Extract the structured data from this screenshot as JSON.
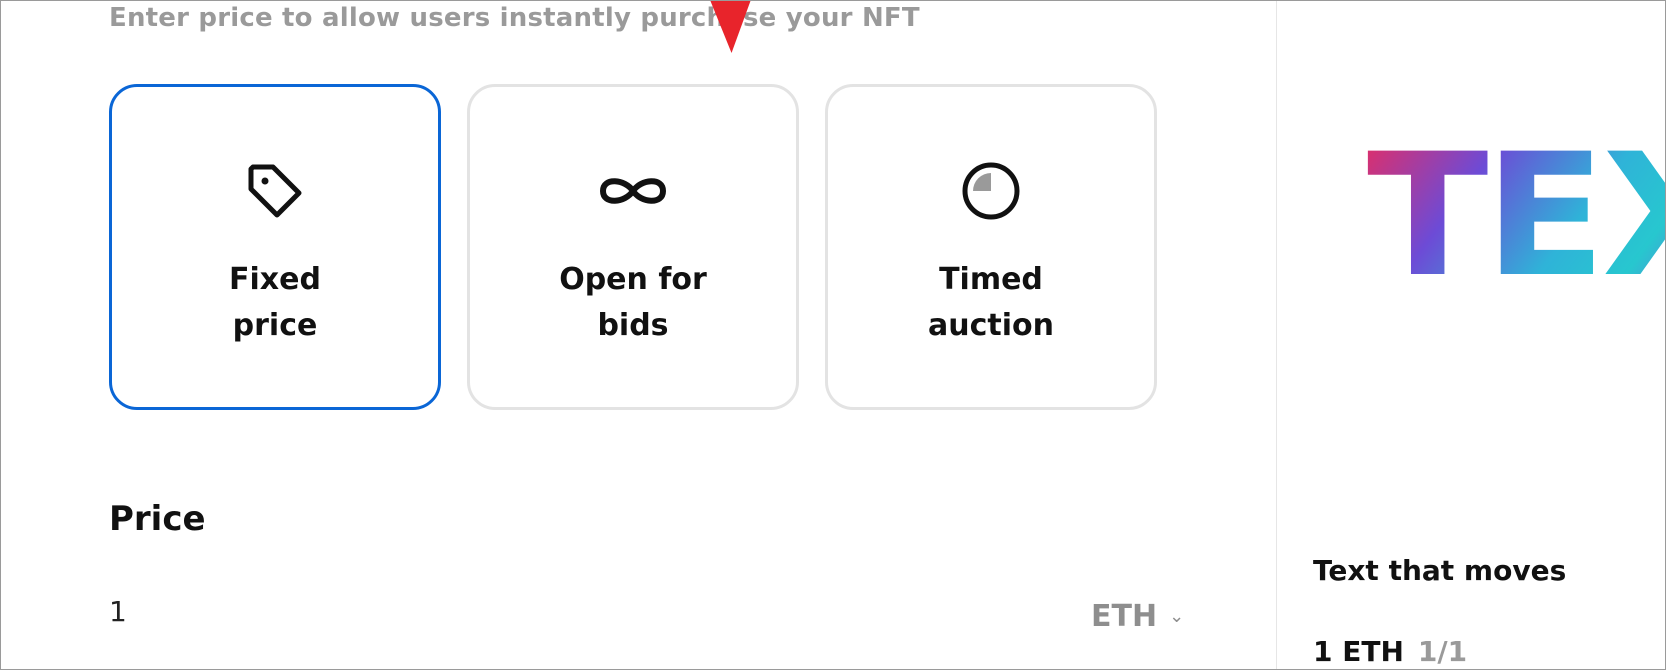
{
  "subtitle": "Enter price to allow users instantly purchase your NFT",
  "sale_options": [
    {
      "label": "Fixed\nprice",
      "icon": "price-tag-icon",
      "selected": true
    },
    {
      "label": "Open for\nbids",
      "icon": "infinity-icon",
      "selected": false
    },
    {
      "label": "Timed\nauction",
      "icon": "timer-icon",
      "selected": false
    }
  ],
  "price": {
    "heading": "Price",
    "value": "1",
    "currency": "ETH",
    "currency_dropdown_icon": "chevron-down-icon"
  },
  "preview": {
    "art_text": "TEXT",
    "title": "Text that moves",
    "price": "1 ETH",
    "edition": "1/1"
  },
  "colors": {
    "selected_border": "#0a66d6",
    "card_border": "#e3e3e3",
    "muted_text": "#9a9a9a"
  }
}
